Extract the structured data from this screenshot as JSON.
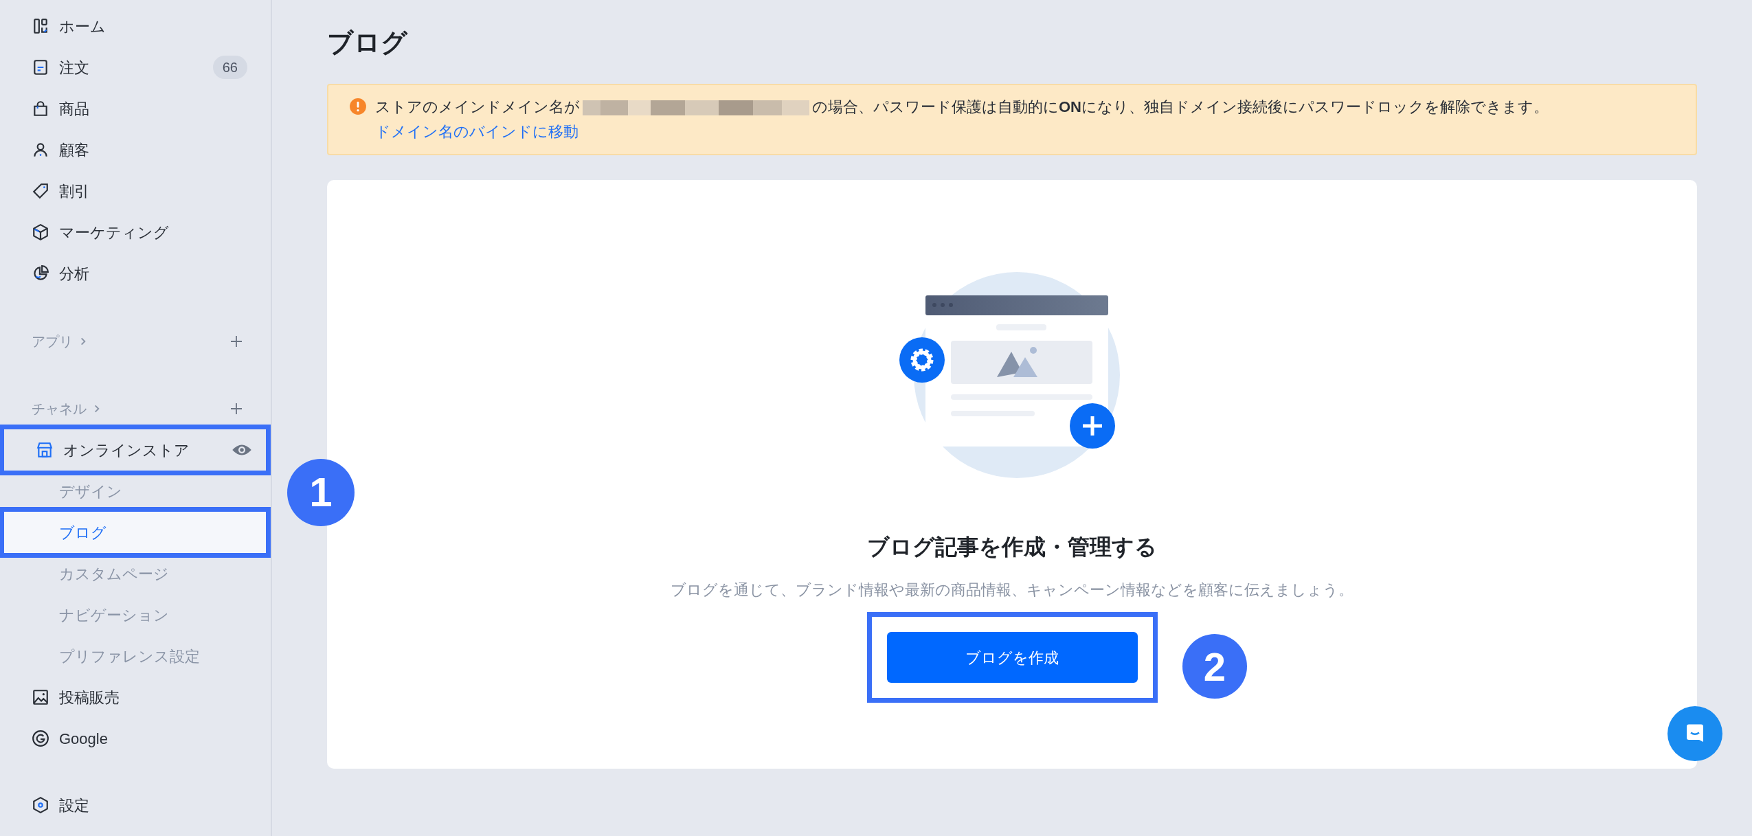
{
  "sidebar": {
    "items": [
      {
        "label": "ホーム",
        "selected": false
      },
      {
        "label": "注文",
        "badge": "66",
        "selected": false
      },
      {
        "label": "商品",
        "selected": false
      },
      {
        "label": "顧客",
        "selected": false
      },
      {
        "label": "割引",
        "selected": false
      },
      {
        "label": "マーケティング",
        "selected": false
      },
      {
        "label": "分析",
        "selected": false
      }
    ],
    "sections": [
      {
        "label": "アプリ"
      },
      {
        "label": "チャネル"
      }
    ],
    "channels": [
      {
        "label": "オンラインストア",
        "annotated": true,
        "selected": false,
        "children": [
          {
            "label": "デザイン",
            "selected": false,
            "annotated": false
          },
          {
            "label": "ブログ",
            "selected": true,
            "annotated": true
          },
          {
            "label": "カスタムページ",
            "selected": false,
            "annotated": false
          },
          {
            "label": "ナビゲーション",
            "selected": false,
            "annotated": false
          },
          {
            "label": "プリファレンス設定",
            "selected": false,
            "annotated": false
          }
        ]
      },
      {
        "label": "投稿販売",
        "annotated": false,
        "selected": false
      },
      {
        "label": "Google",
        "annotated": false,
        "selected": false
      }
    ],
    "footer": {
      "label": "設定"
    }
  },
  "page": {
    "title": "ブログ",
    "notice": {
      "text_before": "ストアのメインドメイン名が",
      "text_after": "の場合、パスワード保護は自動的に**ON**になり、独自ドメイン接続後にパスワードロックを解除できます。",
      "link": "ドメイン名のバインドに移動"
    },
    "empty_state": {
      "heading": "ブログ記事を作成・管理する",
      "description": "ブログを通じて、ブランド情報や最新の商品情報、キャンペーン情報などを顧客に伝えましょう。",
      "button": {
        "label": "ブログを作成",
        "annotated": true
      }
    }
  },
  "callouts": [
    {
      "label": "1"
    },
    {
      "label": "2"
    }
  ]
}
